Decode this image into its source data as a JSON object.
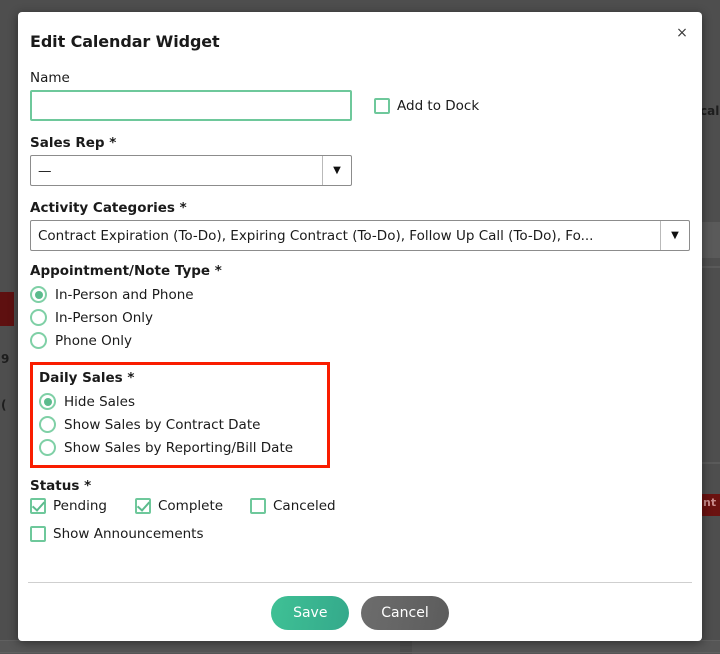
{
  "background": {
    "right_text_fragment": "cal",
    "right_badge_fragment": "nt",
    "left_text_fragment_1": "9",
    "left_text_fragment_2": "("
  },
  "modal": {
    "title": "Edit Calendar Widget",
    "close_label": "×",
    "name": {
      "label": "Name",
      "value": "",
      "placeholder": ""
    },
    "add_to_dock": {
      "label": "Add to Dock",
      "checked": false
    },
    "sales_rep": {
      "label": "Sales Rep *",
      "value": "—",
      "arrow": "▼"
    },
    "activity_categories": {
      "label": "Activity Categories *",
      "value": "Contract Expiration (To-Do), Expiring Contract (To-Do), Follow Up Call (To-Do), Fo...",
      "arrow": "▼"
    },
    "appointment_note_type": {
      "label": "Appointment/Note Type *",
      "options": [
        {
          "label": "In-Person and Phone",
          "selected": true
        },
        {
          "label": "In-Person Only",
          "selected": false
        },
        {
          "label": "Phone Only",
          "selected": false
        }
      ]
    },
    "daily_sales": {
      "label": "Daily Sales *",
      "highlighted": true,
      "highlight_color": "#f91d00",
      "options": [
        {
          "label": "Hide Sales",
          "selected": true
        },
        {
          "label": "Show Sales by Contract Date",
          "selected": false
        },
        {
          "label": "Show Sales by Reporting/Bill Date",
          "selected": false
        }
      ]
    },
    "status": {
      "label": "Status *",
      "options": [
        {
          "label": "Pending",
          "checked": true
        },
        {
          "label": "Complete",
          "checked": true
        },
        {
          "label": "Canceled",
          "checked": false
        }
      ]
    },
    "show_announcements": {
      "label": "Show Announcements",
      "checked": false
    },
    "footer": {
      "save_label": "Save",
      "cancel_label": "Cancel"
    }
  },
  "colors": {
    "accent_green": "#5cbb8d",
    "control_green": "#6ec89b",
    "highlight_red": "#f91d00",
    "backdrop": "#4e4e4e"
  }
}
